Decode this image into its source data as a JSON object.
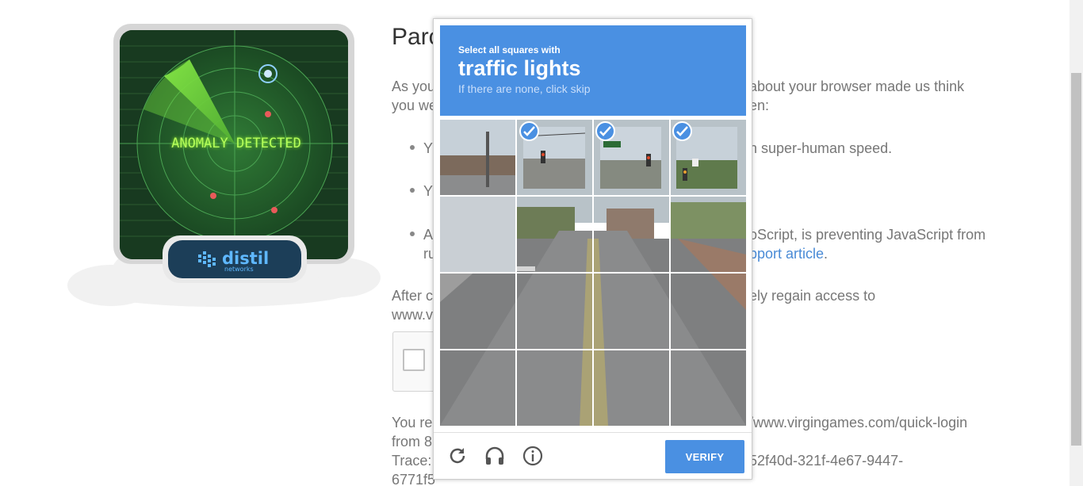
{
  "distil": {
    "anomaly_text": "ANOMALY DETECTED",
    "brand_name": "distil",
    "brand_sub": "networks"
  },
  "page": {
    "title_fragment": "Parc",
    "intro_left": "As you",
    "intro_right": "about your browser made us think",
    "intro_left_2": "you we",
    "intro_right_2": "en:",
    "bullet1_left": "Y",
    "bullet1_right": "h super-human speed.",
    "bullet2_left": "Y",
    "bullet3_left": "A",
    "bullet3_right": "oScript, is preventing JavaScript from",
    "bullet3_left_2": "ru",
    "bullet3_link": "pport article",
    "bullet3_period": ".",
    "after_left": "After c",
    "after_right": "ely regain access to",
    "after_left_2": "www.v",
    "reached_left": "You re",
    "reached_right": "/www.virgingames.com/quick-login",
    "from_left": "from 8",
    "trace_left": "Trace:",
    "trace_right": "52f40d-321f-4e67-9447-",
    "trace_left_2": "6771f5"
  },
  "captcha": {
    "instruction_small": "Select all squares with",
    "instruction_target": "traffic lights",
    "instruction_hint": "If there are none, click skip",
    "verify_label": "VERIFY",
    "selected_tiles": [
      1,
      2,
      3
    ],
    "accent_color": "#4a90e2"
  }
}
